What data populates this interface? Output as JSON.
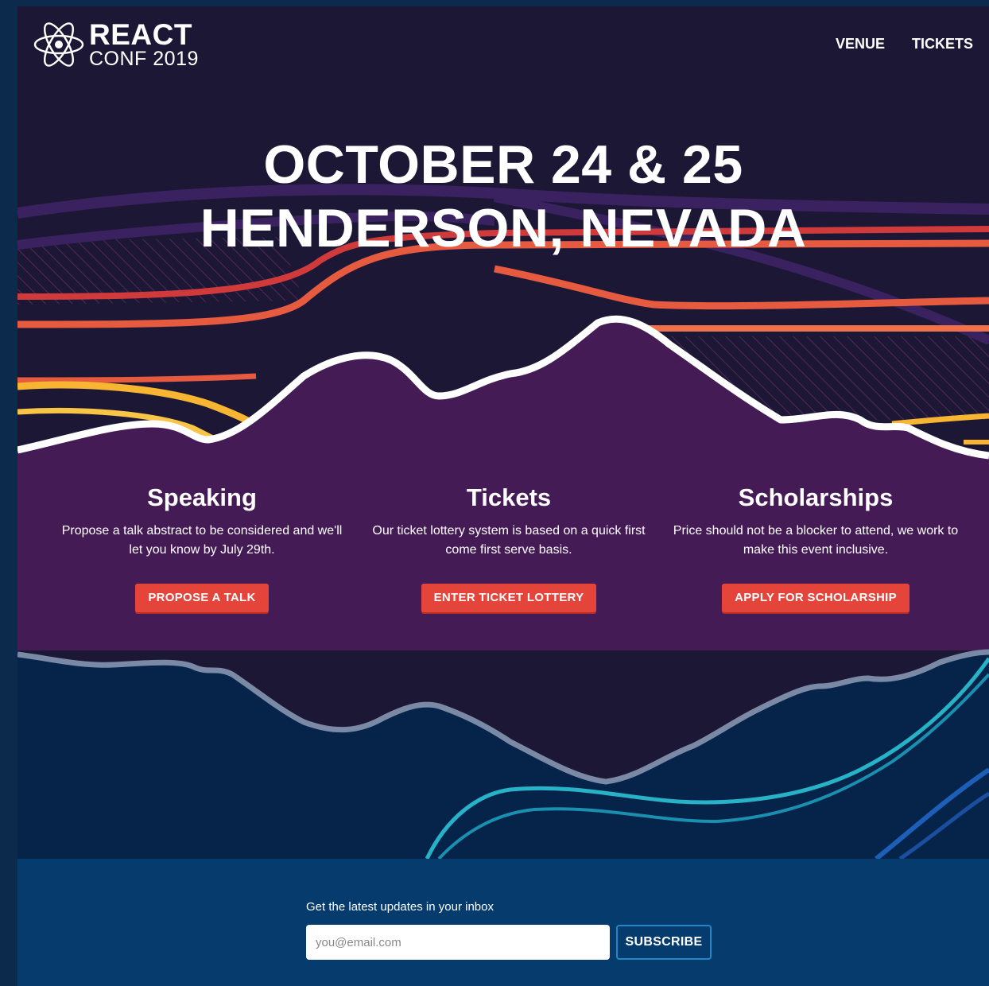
{
  "brand": {
    "title": "REACT",
    "subtitle": "CONF 2019"
  },
  "nav": [
    {
      "label": "VENUE"
    },
    {
      "label": "TICKETS"
    }
  ],
  "hero": {
    "date": "OCTOBER 24 & 25",
    "location": "HENDERSON, NEVADA"
  },
  "cards": [
    {
      "heading": "Speaking",
      "text": "Propose a talk abstract to be considered and we'll let you know by July 29th.",
      "button": "PROPOSE A TALK"
    },
    {
      "heading": "Tickets",
      "text": "Our ticket lottery system is based on a quick first come first serve basis.",
      "button": "ENTER TICKET LOTTERY"
    },
    {
      "heading": "Scholarships",
      "text": "Price should not be a blocker to attend, we work to make this event inclusive.",
      "button": "APPLY FOR SCHOLARSHIP"
    }
  ],
  "newsletter": {
    "label": "Get the latest updates in your inbox",
    "placeholder": "you@email.com",
    "button": "SUBSCRIBE"
  },
  "colors": {
    "background": "#1d1736",
    "mountain": "#451b56",
    "lake": "#062349",
    "accent": "#e4443a",
    "footer": "#063b6e"
  }
}
